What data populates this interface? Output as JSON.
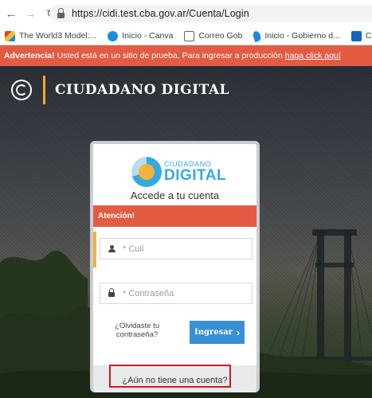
{
  "browser": {
    "url": "https://cidi.test.cba.gov.ar/Cuenta/Login",
    "bookmarks": [
      {
        "label": "The World3 Model:...",
        "icon": "world3-icon"
      },
      {
        "label": "Inicio - Canva",
        "icon": "canva-icon"
      },
      {
        "label": "Correo Gob",
        "icon": "mail-icon"
      },
      {
        "label": "Inicio - Gobierno d...",
        "icon": "gobierno-icon"
      },
      {
        "label": "Conviérte",
        "icon": "convierte-icon"
      }
    ]
  },
  "warning": {
    "strong": "Advertencia!",
    "text": "Usted está en un sitio de prueba. Para ingresar a producción",
    "link": "haga click aquí"
  },
  "header": {
    "title": "CIUDADANO DIGITAL"
  },
  "login": {
    "logo_top": "CIUDADANO",
    "logo_main": "DIGITAL",
    "subtitle": "Accede a tu cuenta",
    "alert_title": "Atención!",
    "cuil_placeholder": "* Cuil",
    "password_placeholder": "* Contraseña",
    "forgot_line1": "¿Olvidaste tu",
    "forgot_line2": "contraseña?",
    "submit_label": "Ingresar",
    "no_account": "¿Aún no tiene una cuenta?"
  },
  "colors": {
    "warning_bg": "#e35b43",
    "accent_yellow": "#f2b33d",
    "button_blue": "#3a8fd6",
    "logo_blue": "#36a9e1",
    "highlight_red": "#d0191c"
  }
}
